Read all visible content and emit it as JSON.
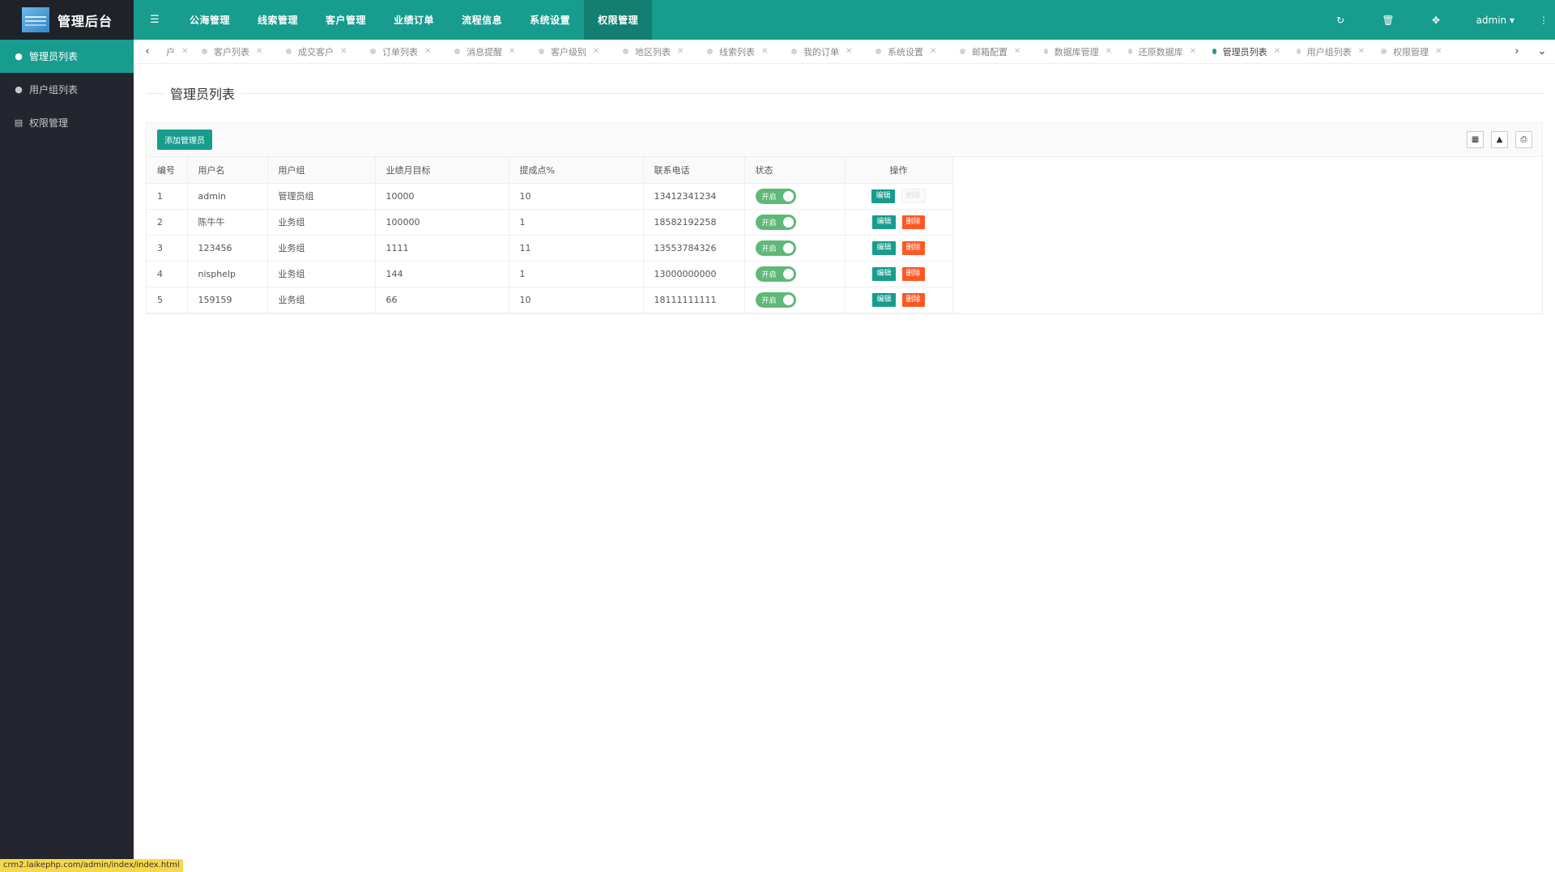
{
  "app": {
    "title": "管理后台"
  },
  "sidebar": {
    "items": [
      {
        "label": "管理员列表",
        "icon": "user-icon",
        "active": true
      },
      {
        "label": "用户组列表",
        "icon": "users-icon",
        "active": false
      },
      {
        "label": "权限管理",
        "icon": "id-card-icon",
        "active": false
      }
    ]
  },
  "topnav": {
    "items": [
      "公海管理",
      "线索管理",
      "客户管理",
      "业绩订单",
      "流程信息",
      "系统设置",
      "权限管理"
    ],
    "active": "权限管理",
    "user": "admin"
  },
  "tabs": {
    "first_partial": "户",
    "items": [
      "客户列表",
      "成交客户",
      "订单列表",
      "消息提醒",
      "客户级别",
      "地区列表",
      "线索列表",
      "我的订单",
      "系统设置",
      "邮箱配置",
      "数据库管理",
      "还原数据库",
      "管理员列表",
      "用户组列表",
      "权限管理"
    ],
    "active": "管理员列表"
  },
  "page": {
    "title": "管理员列表",
    "add_button": "添加管理员"
  },
  "table": {
    "headers": [
      "编号",
      "用户名",
      "用户组",
      "业绩月目标",
      "提成点%",
      "联系电话",
      "状态",
      "操作"
    ],
    "rows": [
      {
        "id": "1",
        "username": "admin",
        "group": "管理员组",
        "target": "10000",
        "commission": "10",
        "phone": "13412341234",
        "status": "开启",
        "edit": "编辑",
        "delete": "删除",
        "delete_disabled": true
      },
      {
        "id": "2",
        "username": "陈牛牛",
        "group": "业务组",
        "target": "100000",
        "commission": "1",
        "phone": "18582192258",
        "status": "开启",
        "edit": "编辑",
        "delete": "删除",
        "delete_disabled": false
      },
      {
        "id": "3",
        "username": "123456",
        "group": "业务组",
        "target": "1111",
        "commission": "11",
        "phone": "13553784326",
        "status": "开启",
        "edit": "编辑",
        "delete": "删除",
        "delete_disabled": false
      },
      {
        "id": "4",
        "username": "nisphelp",
        "group": "业务组",
        "target": "144",
        "commission": "1",
        "phone": "13000000000",
        "status": "开启",
        "edit": "编辑",
        "delete": "删除",
        "delete_disabled": false
      },
      {
        "id": "5",
        "username": "159159",
        "group": "业务组",
        "target": "66",
        "commission": "10",
        "phone": "18111111111",
        "status": "开启",
        "edit": "编辑",
        "delete": "删除",
        "delete_disabled": false
      }
    ]
  },
  "status_bar": {
    "url": "crm2.laikephp.com/admin/index/index.html"
  },
  "colors": {
    "primary": "#179c8e",
    "sidebar": "#23262e",
    "danger": "#ff5722",
    "switch_on": "#5fb878"
  }
}
